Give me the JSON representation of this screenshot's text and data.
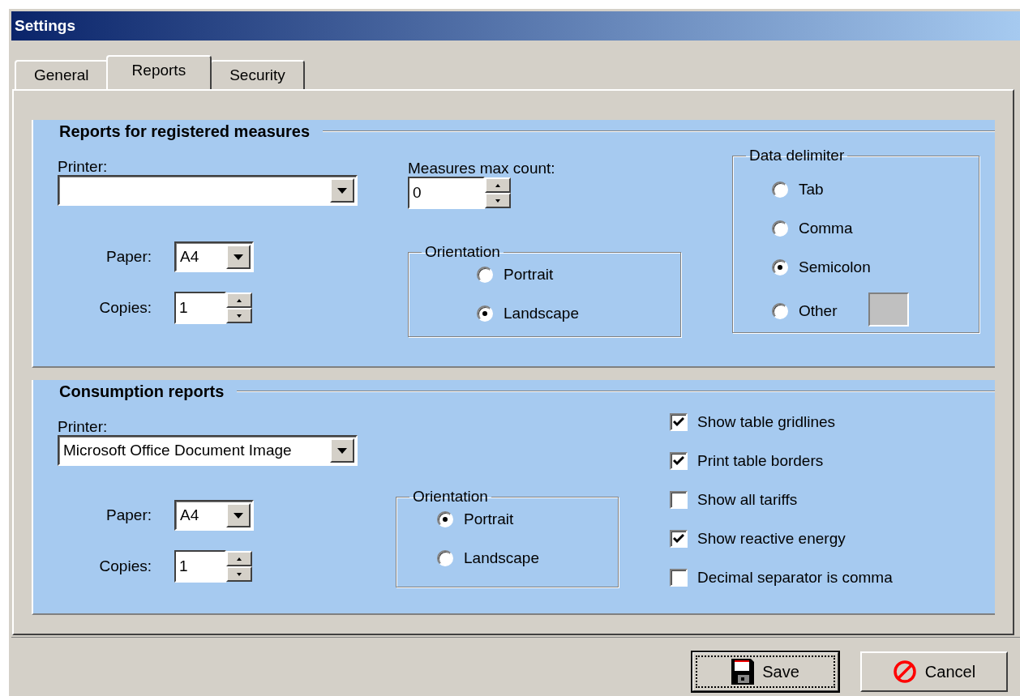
{
  "window": {
    "title": "Settings"
  },
  "tabs": [
    {
      "label": "General",
      "selected": false
    },
    {
      "label": "Reports",
      "selected": true
    },
    {
      "label": "Security",
      "selected": false
    }
  ],
  "reports_section": {
    "title": "Reports for registered measures",
    "printer": {
      "label": "Printer:"
    },
    "paper": {
      "label": "Paper:",
      "value": "A4"
    },
    "copies": {
      "label": "Copies:",
      "value": "1"
    },
    "max_count": {
      "label": "Measures max count:",
      "value": "0"
    },
    "orientation": {
      "title": "Orientation",
      "options": [
        {
          "label": "Portrait",
          "selected": false
        },
        {
          "label": "Landscape",
          "selected": true
        }
      ]
    },
    "delimiter": {
      "title": "Data delimiter",
      "options": [
        {
          "label": "Tab",
          "selected": false,
          "kind": "plain"
        },
        {
          "label": "Comma",
          "selected": false,
          "kind": "plain"
        },
        {
          "label": "Semicolon",
          "selected": true,
          "kind": "plain"
        },
        {
          "label": "Other",
          "selected": false,
          "kind": "with_field",
          "field_disabled": true
        }
      ]
    }
  },
  "consumption_section": {
    "title": "Consumption reports",
    "printer": {
      "label": "Printer:",
      "value": "Microsoft Office Document Image"
    },
    "paper": {
      "label": "Paper:",
      "value": "A4"
    },
    "copies": {
      "label": "Copies:",
      "value": "1"
    },
    "orientation": {
      "title": "Orientation",
      "options": [
        {
          "label": "Portrait",
          "selected": true
        },
        {
          "label": "Landscape",
          "selected": false
        }
      ]
    },
    "options": [
      {
        "label": "Show table gridlines",
        "checked": true
      },
      {
        "label": "Print table borders",
        "checked": true
      },
      {
        "label": "Show all tariffs",
        "checked": false
      },
      {
        "label": "Show reactive energy",
        "checked": true
      },
      {
        "label": "Decimal separator is comma",
        "checked": false
      }
    ]
  },
  "buttons": [
    {
      "label": "Save",
      "kind": "save",
      "focused": true
    },
    {
      "label": "Cancel",
      "kind": "cancel",
      "focused": false
    }
  ]
}
